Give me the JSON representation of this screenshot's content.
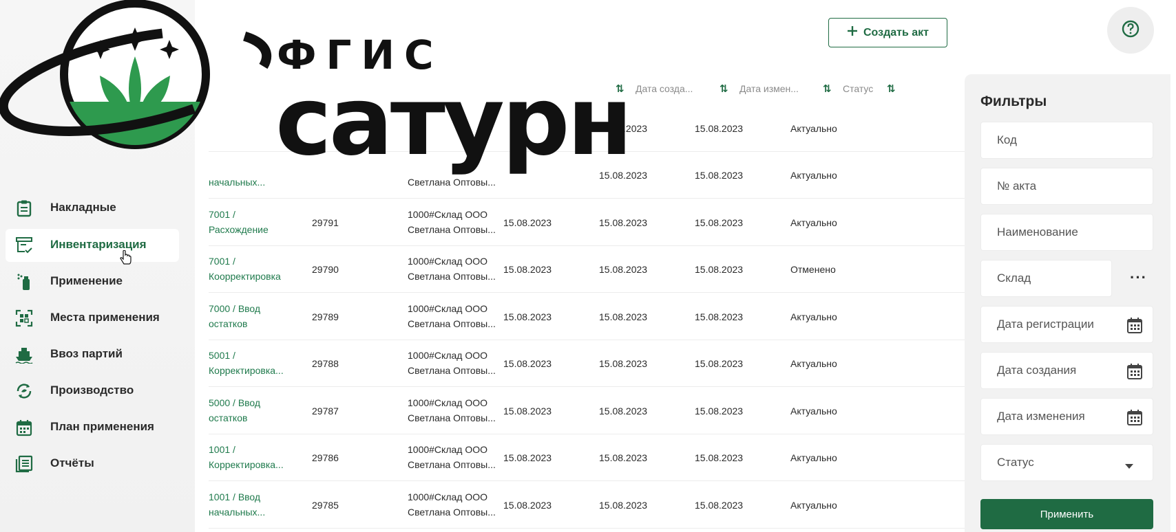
{
  "logo": {
    "small_text": "ФГИС",
    "big_text": "сатурн"
  },
  "header": {
    "create_button_label": "Создать акт"
  },
  "sidebar": {
    "items": [
      {
        "label": "Накладные",
        "icon": "clipboard-icon",
        "active": false
      },
      {
        "label": "Инвентаризация",
        "icon": "inventory-icon",
        "active": true
      },
      {
        "label": "Применение",
        "icon": "sprayer-icon",
        "active": false
      },
      {
        "label": "Места применения",
        "icon": "field-map-icon",
        "active": false
      },
      {
        "label": "Ввоз партий",
        "icon": "ship-icon",
        "active": false
      },
      {
        "label": "Производство",
        "icon": "production-icon",
        "active": false
      },
      {
        "label": "План применения",
        "icon": "calendar-icon",
        "active": false
      },
      {
        "label": "Отчёты",
        "icon": "reports-icon",
        "active": false
      }
    ]
  },
  "table": {
    "headers": [
      "Дата созда...",
      "Дата измен...",
      "Статус"
    ],
    "rows": [
      {
        "type": [
          "",
          ""
        ],
        "code": "",
        "warehouse": [
          "",
          ""
        ],
        "reg_date": "",
        "created": "15.08.2023",
        "changed": "15.08.2023",
        "status": "Актуально"
      },
      {
        "type": [
          "",
          "начальных..."
        ],
        "code": "",
        "warehouse": [
          "",
          "Светлана Оптовы..."
        ],
        "reg_date": "",
        "created": "15.08.2023",
        "changed": "15.08.2023",
        "status": "Актуально"
      },
      {
        "type": [
          "7001 /",
          "Расхождение"
        ],
        "code": "29791",
        "warehouse": [
          "1000#Склад ООО",
          "Светлана Оптовы..."
        ],
        "reg_date": "15.08.2023",
        "created": "15.08.2023",
        "changed": "15.08.2023",
        "status": "Актуально"
      },
      {
        "type": [
          "7001 /",
          "Коорректировка"
        ],
        "code": "29790",
        "warehouse": [
          "1000#Склад ООО",
          "Светлана Оптовы..."
        ],
        "reg_date": "15.08.2023",
        "created": "15.08.2023",
        "changed": "15.08.2023",
        "status": "Отменено"
      },
      {
        "type": [
          "7000 / Ввод",
          "остатков"
        ],
        "code": "29789",
        "warehouse": [
          "1000#Склад ООО",
          "Светлана Оптовы..."
        ],
        "reg_date": "15.08.2023",
        "created": "15.08.2023",
        "changed": "15.08.2023",
        "status": "Актуально"
      },
      {
        "type": [
          "5001 /",
          "Корректировка..."
        ],
        "code": "29788",
        "warehouse": [
          "1000#Склад ООО",
          "Светлана Оптовы..."
        ],
        "reg_date": "15.08.2023",
        "created": "15.08.2023",
        "changed": "15.08.2023",
        "status": "Актуально"
      },
      {
        "type": [
          "5000 / Ввод",
          "остатков"
        ],
        "code": "29787",
        "warehouse": [
          "1000#Склад ООО",
          "Светлана Оптовы..."
        ],
        "reg_date": "15.08.2023",
        "created": "15.08.2023",
        "changed": "15.08.2023",
        "status": "Актуально"
      },
      {
        "type": [
          "1001 /",
          "Корректировка..."
        ],
        "code": "29786",
        "warehouse": [
          "1000#Склад ООО",
          "Светлана Оптовы..."
        ],
        "reg_date": "15.08.2023",
        "created": "15.08.2023",
        "changed": "15.08.2023",
        "status": "Актуально"
      },
      {
        "type": [
          "1001 / Ввод",
          "начальных..."
        ],
        "code": "29785",
        "warehouse": [
          "1000#Склад ООО",
          "Светлана Оптовы..."
        ],
        "reg_date": "15.08.2023",
        "created": "15.08.2023",
        "changed": "15.08.2023",
        "status": "Актуально"
      }
    ]
  },
  "filters": {
    "title": "Фильтры",
    "code_placeholder": "Код",
    "act_number_placeholder": "№ акта",
    "name_placeholder": "Наименование",
    "warehouse_placeholder": "Склад",
    "reg_date_placeholder": "Дата регистрации",
    "created_date_placeholder": "Дата создания",
    "changed_date_placeholder": "Дата изменения",
    "status_placeholder": "Статус",
    "apply_label": "Применить"
  },
  "colors": {
    "brand_green": "#1f6b43",
    "link_green": "#1f7a4c",
    "logo_black": "#111111"
  }
}
